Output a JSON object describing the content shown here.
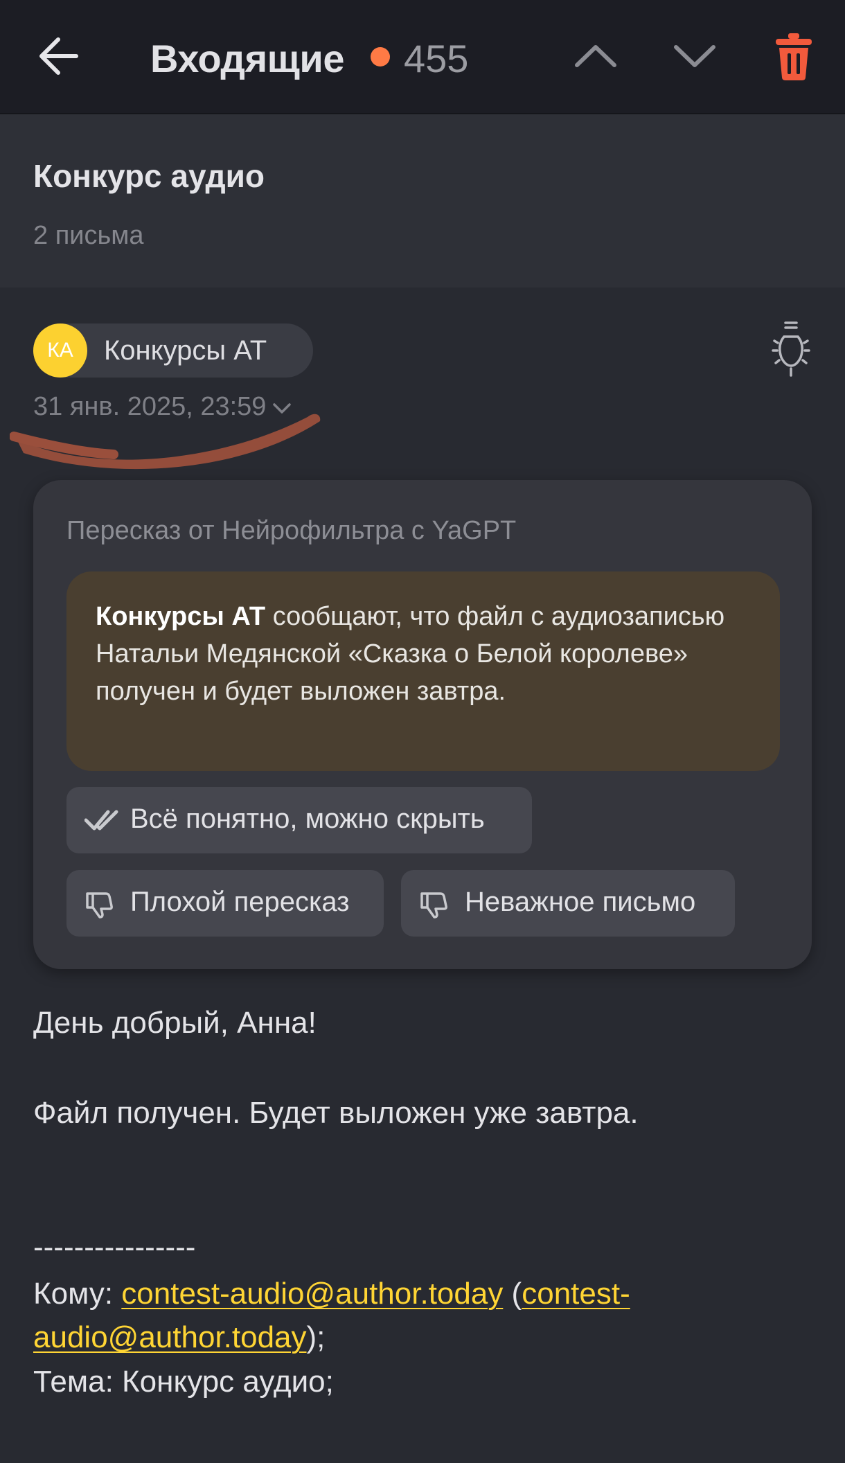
{
  "header": {
    "title": "Входящие",
    "unread_count": "455",
    "unread_dot_color": "#ff7a45",
    "icons": [
      "back-arrow-icon",
      "chevron-up-icon",
      "chevron-down-icon",
      "trash-icon"
    ]
  },
  "thread": {
    "subject": "Конкурс аудио",
    "letters_count": "2 письма"
  },
  "message": {
    "sender_initials": "КА",
    "sender_name": "Конкурсы АТ",
    "date": "31 янв. 2025, 23:59",
    "avatar_color": "#fcd130"
  },
  "summary": {
    "heading": "Пересказ от Нейрофильтра с YaGPT",
    "sender_bold": "Конкурсы АТ",
    "text": " сообщают, что файл с аудиозаписью Натальи Медянской «Сказка о Белой королеве» получен и будет выложен завтра.",
    "hide_label": "Всё понятно, можно скрыть",
    "bad_label": "Плохой пересказ",
    "unimportant_label": "Неважное письмо"
  },
  "body": {
    "greeting": "День добрый, Анна!",
    "text": "Файл получен. Будет выложен уже завтра.",
    "separator": "----------------",
    "to_label": "Кому: ",
    "to_email": "contest-audio@author.today",
    "to_paren_open": " (",
    "to_email_alt_part1": "contest-",
    "to_email_alt_part2": "audio@author.today",
    "to_paren_close": ");",
    "subject_line": "Тема: Конкурс аудио;",
    "link_color": "#ffd534"
  }
}
